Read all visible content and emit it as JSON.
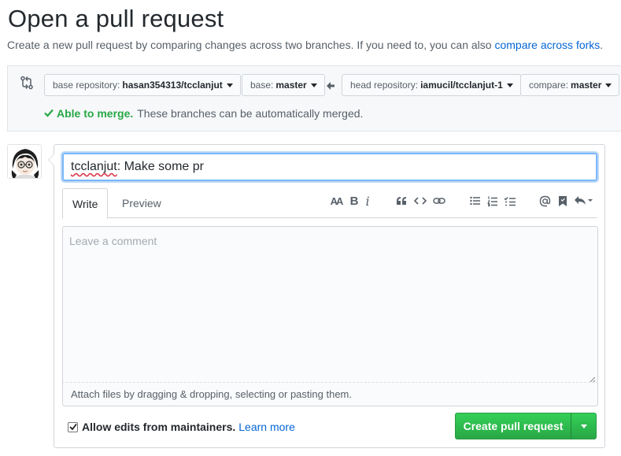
{
  "page": {
    "title": "Open a pull request",
    "subtitle_text": "Create a new pull request by comparing changes across two branches. If you need to, you can also",
    "subtitle_link": "compare across forks",
    "subtitle_end": "."
  },
  "range": {
    "base_repo_label": "base repository:",
    "base_repo_value": "hasan354313/tcclanjut",
    "base_label": "base:",
    "base_value": "master",
    "head_repo_label": "head repository:",
    "head_repo_value": "iamucil/tcclanjut-1",
    "compare_label": "compare:",
    "compare_value": "master",
    "merge_status": "Able to merge.",
    "merge_detail": "These branches can be automatically merged."
  },
  "form": {
    "title_prefix": "tcclanjut",
    "title_rest": ": Make some pr",
    "tabs": [
      "Write",
      "Preview"
    ],
    "comment_placeholder": "Leave a comment",
    "attach_text": "Attach files by dragging & dropping, selecting or pasting them.",
    "allow_edits_label": "Allow edits from maintainers.",
    "allow_edits_checked": true,
    "learn_more": "Learn more",
    "submit_label": "Create pull request"
  },
  "toolbar": {
    "heading_icon_text": "AA",
    "bold_icon_text": "B",
    "italic_icon_text": "i",
    "icons": [
      "header-icon",
      "bold-icon",
      "italic-icon",
      "quote-icon",
      "code-icon",
      "link-icon",
      "unordered-list-icon",
      "ordered-list-icon",
      "task-list-icon",
      "mention-icon",
      "saved-reply-icon",
      "reply-icon"
    ]
  },
  "colors": {
    "accent_blue": "#0366d6",
    "success_green": "#28a745",
    "text": "#24292e",
    "muted": "#586069"
  }
}
